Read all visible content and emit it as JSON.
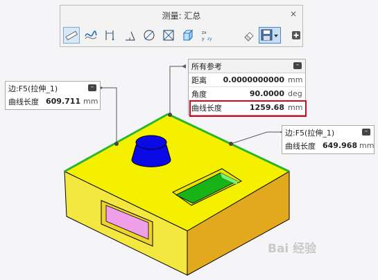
{
  "toolbar": {
    "title": "测量: 汇总",
    "close_glyph": "×",
    "tools": [
      "ruler-icon",
      "curve-length-icon",
      "distance-icon",
      "angle-icon",
      "diameter-icon",
      "area-icon",
      "volume-icon",
      "transform-icon",
      "eraser-icon",
      "save-icon",
      "dropdown-arrow-icon",
      "add-icon"
    ]
  },
  "summary": {
    "title": "所有参考",
    "rows": [
      {
        "label": "距离",
        "value": "0.0000000000",
        "unit": "mm"
      },
      {
        "label": "角度",
        "value": "90.0000",
        "unit": "deg"
      },
      {
        "label": "曲线长度",
        "value": "1259.68",
        "unit": "mm"
      }
    ]
  },
  "left_callout": {
    "title": "边:F5(拉伸_1)",
    "label": "曲线长度",
    "value": "609.711",
    "unit": "mm"
  },
  "right_callout": {
    "title": "边:F5(拉伸_1)",
    "label": "曲线长度",
    "value": "649.968",
    "unit": "mm"
  },
  "watermark": "Bai 经验",
  "colors": {
    "top_face": "#f5f000",
    "front_face": "#f3e740",
    "right_face": "#e3a91e",
    "edge_highlight": "#2ab52a",
    "cylinder": "#0a0ae6",
    "pocket_top": "#17b317",
    "pocket_side": "#e97ad6",
    "highlight_box": "#e0001b"
  }
}
